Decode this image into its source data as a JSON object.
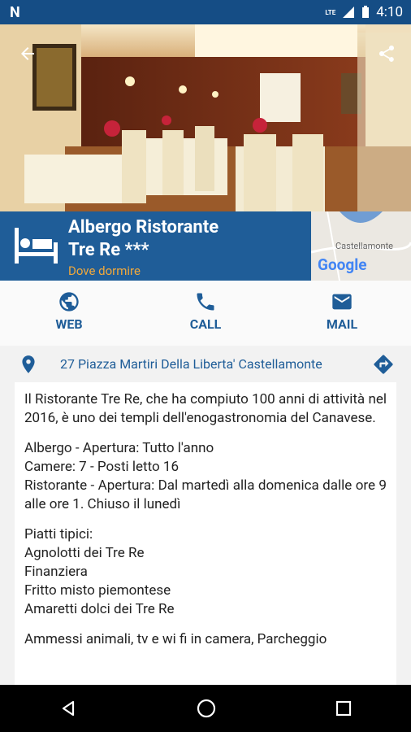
{
  "status": {
    "time": "4:10",
    "network": "LTE"
  },
  "hero": {
    "alt": "restaurant dining room"
  },
  "title": {
    "line1": "Albergo Ristorante",
    "line2": "Tre Re ***",
    "category": "Dove dormire"
  },
  "map": {
    "city": "Castellamonte",
    "brand": "Google"
  },
  "actions": {
    "web": "WEB",
    "call": "CALL",
    "mail": "MAIL"
  },
  "address": "27 Piazza Martiri Della Liberta' Castellamonte",
  "content": {
    "intro": "Il Ristorante Tre Re, che ha compiuto 100 anni di attività nel 2016, è uno dei templi dell'enogastronomia del Canavese.",
    "hotel": "Albergo - Apertura: Tutto l'anno",
    "rooms": "Camere: 7 - Posti letto 16",
    "restaurant": "Ristorante - Apertura:  Dal martedì alla domenica dalle ore 9 alle ore 1.  Chiuso il lunedì",
    "dishes_title": "Piatti tipici:",
    "dish1": "Agnolotti dei Tre Re",
    "dish2": "Finanziera",
    "dish3": "Fritto misto piemontese",
    "dish4": "Amaretti dolci dei Tre Re",
    "extra": "Ammessi animali, tv e wi fi in camera, Parcheggio"
  }
}
